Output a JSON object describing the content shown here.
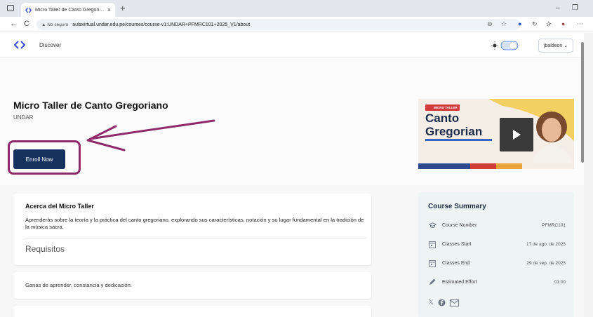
{
  "browser": {
    "tab_title": "Micro Taller de Canto Gregorian",
    "tab_close": "×",
    "new_tab": "+",
    "back": "←",
    "reload": "C",
    "security_label": "▲ No seguro",
    "url": "aulavirtual.undar.edu.pe/courses/course-v1:UNDAR+PFMRC101+2025_V1/about",
    "minimize": "–",
    "restore": "❐"
  },
  "header": {
    "nav_discover": "Discover",
    "user": "jbaldeon ⌄"
  },
  "hero": {
    "title": "Micro Taller de Canto Gregoriano",
    "org": "UNDAR",
    "enroll_label": "Enroll Now",
    "annotation_color": "#8e2a6b"
  },
  "video": {
    "badge": "MICRO TALLER",
    "line1": "Canto",
    "line2": "Gregorian"
  },
  "about": {
    "title": "Acerca del Micro Taller",
    "text": "Aprenderás sobre la teoría y la práctica del canto gregoriano, explorando sus características, notación y su lugar fundamental en la tradición de la música sacra.",
    "requirements_title": "Requisitos",
    "requirements_text": "Ganas de aprender, constancia y dedicación."
  },
  "summary": {
    "title": "Course Summary",
    "rows": [
      {
        "label": "Course Number",
        "value": "PFMRC101",
        "icon": "graduation-cap-icon"
      },
      {
        "label": "Classes Start",
        "value": "17 de ago. de 2025",
        "icon": "calendar-icon"
      },
      {
        "label": "Classes End",
        "value": "29 de sep. de 2025",
        "icon": "calendar-icon"
      },
      {
        "label": "Estimated Effort",
        "value": "01:00",
        "icon": "pencil-icon"
      }
    ]
  },
  "colors": {
    "primary": "#17325f",
    "annotation": "#8e2a6b",
    "summary_bg": "#eef4f4"
  }
}
